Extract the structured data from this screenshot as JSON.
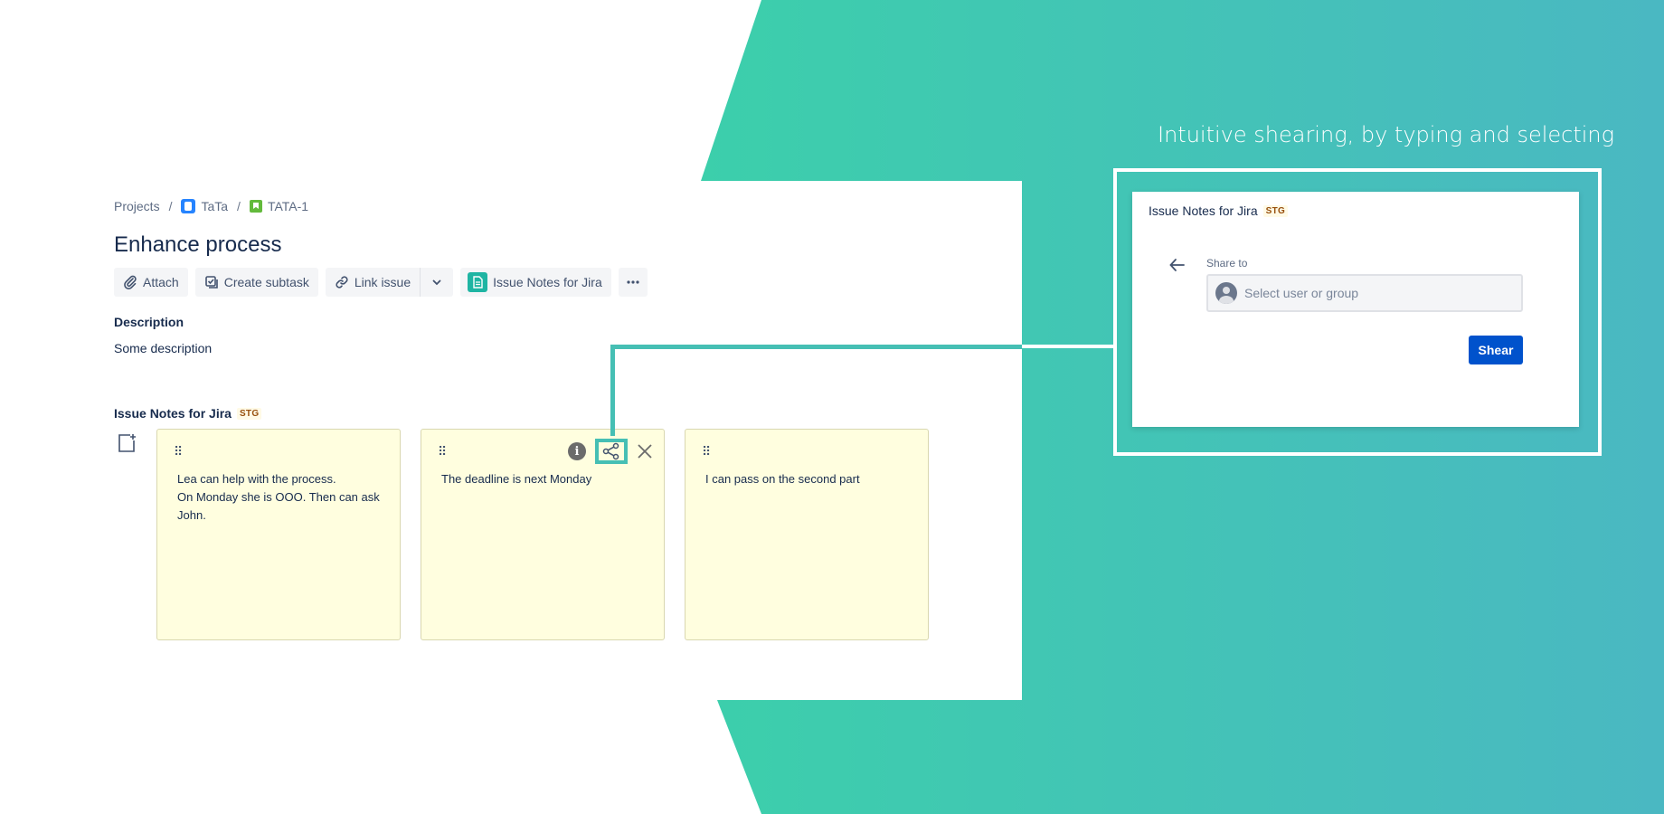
{
  "colors": {
    "teal_start": "#3ccfab",
    "teal_end": "#4ab8c2",
    "accent_teal": "#46bfb4",
    "note_bg": "#fffedf",
    "primary_button": "#0052cc"
  },
  "headline": "Intuitive shearing, by typing and selecting",
  "breadcrumb": {
    "items": [
      {
        "label": "Projects",
        "icon": ""
      },
      {
        "label": "TaTa",
        "icon": "project-icon"
      },
      {
        "label": "TATA-1",
        "icon": "story-icon"
      }
    ],
    "separator": "/"
  },
  "issue": {
    "title": "Enhance process"
  },
  "toolbar": {
    "attach": "Attach",
    "create_subtask": "Create subtask",
    "link_issue": "Link issue",
    "notes_app": "Issue Notes for Jira"
  },
  "description": {
    "label": "Description",
    "text": "Some description"
  },
  "notes_section": {
    "label": "Issue Notes for Jira",
    "badge": "STG",
    "notes": [
      {
        "lines": [
          "Lea can help with the process.",
          "On Monday she is OOO. Then can ask John."
        ]
      },
      {
        "lines": [
          "The deadline is next Monday"
        ]
      },
      {
        "lines": [
          "I can pass on the second part"
        ]
      }
    ]
  },
  "share_dialog": {
    "title": "Issue Notes for Jira",
    "badge": "STG",
    "field_label": "Share to",
    "placeholder": "Select user or group",
    "submit": "Shear"
  }
}
